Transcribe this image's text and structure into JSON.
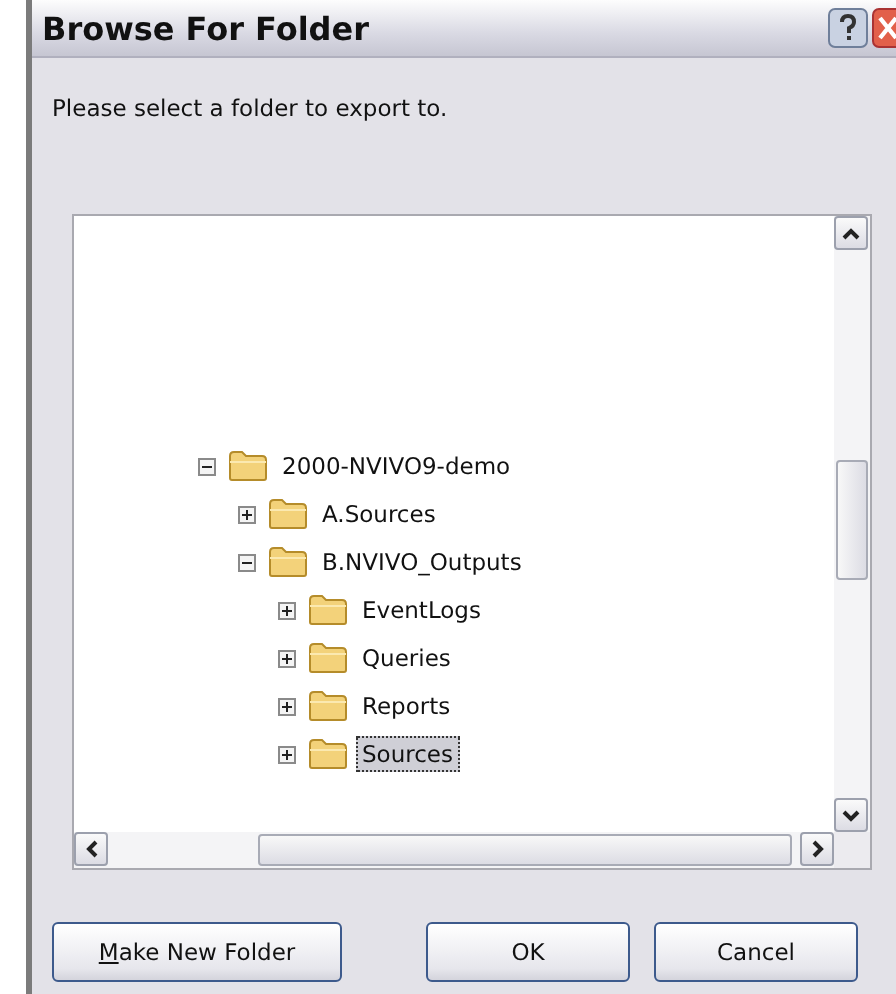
{
  "window": {
    "title": "Browse For Folder"
  },
  "prompt": "Please select a folder to export to.",
  "tree": [
    {
      "label": "2000-NVIVO9-demo",
      "expanded": true,
      "selected": false,
      "children": [
        {
          "label": "A.Sources",
          "expanded": false,
          "selected": false
        },
        {
          "label": "B.NVIVO_Outputs",
          "expanded": true,
          "selected": false,
          "children": [
            {
              "label": "EventLogs",
              "expanded": false,
              "selected": false
            },
            {
              "label": "Queries",
              "expanded": false,
              "selected": false
            },
            {
              "label": "Reports",
              "expanded": false,
              "selected": false
            },
            {
              "label": "Sources",
              "expanded": false,
              "selected": true
            }
          ]
        }
      ]
    }
  ],
  "buttons": [
    "Make New Folder",
    "OK",
    "Cancel"
  ]
}
